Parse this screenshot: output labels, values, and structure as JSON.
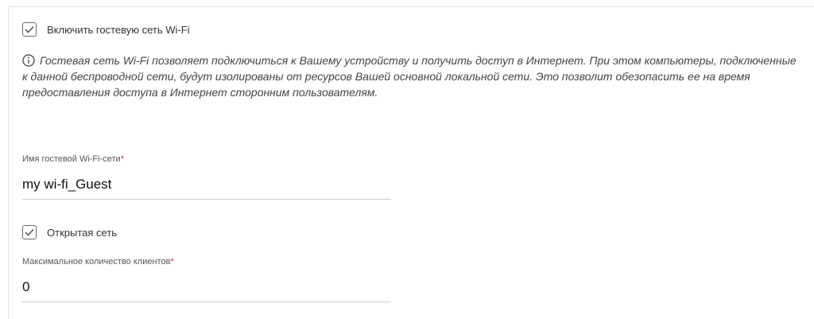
{
  "guest_wifi": {
    "enable_label": "Включить гостевую сеть Wi-Fi",
    "enable_checked": true,
    "info_text": "Гостевая сеть Wi-Fi позволяет подключиться к Вашему устройству и получить доступ в Интернет. При этом компьютеры, подключенные к данной беспроводной сети, будут изолированы от ресурсов Вашей основной локальной сети. Это позволит обезопасить ее на время предоставления доступа в Интернет сторонним пользователям.",
    "ssid": {
      "label": "Имя гостевой Wi-Fi-сети",
      "required_mark": "*",
      "value": "my wi-fi_Guest"
    },
    "open_network_label": "Открытая сеть",
    "open_network_checked": true,
    "max_clients": {
      "label": "Максимальное количество клиентов",
      "required_mark": "*",
      "value": "0"
    }
  },
  "icons": {
    "checkbox_check": "check-icon",
    "info": "info-circle-icon"
  },
  "colors": {
    "required": "#d0312d",
    "checkbox_border": "#6b6b6b",
    "underline": "#cfcfcf"
  }
}
